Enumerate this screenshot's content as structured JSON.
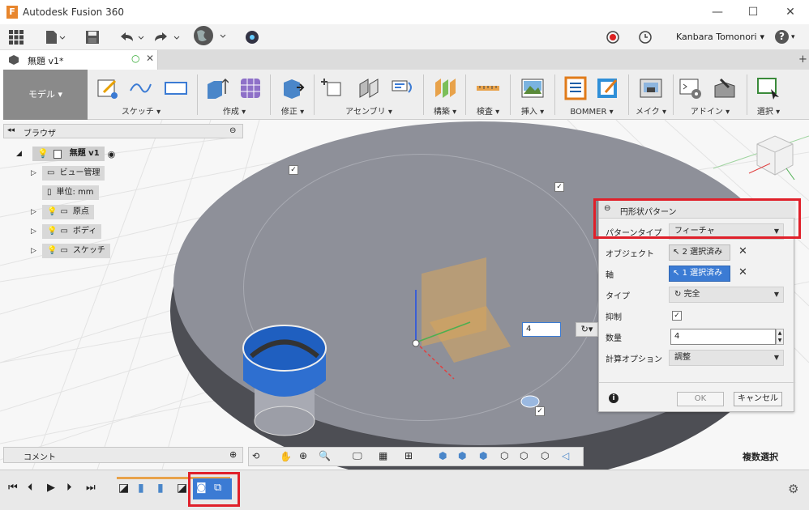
{
  "window": {
    "title": "Autodesk Fusion 360",
    "minimize": "—",
    "maximize": "☐",
    "close": "✕"
  },
  "qat": {
    "user": "Kanbara Tomonori",
    "help": "?"
  },
  "tab": {
    "name": "無題 v1*"
  },
  "ribbon": {
    "workspace": "モデル ▾",
    "groups": [
      {
        "label": "スケッチ ▾"
      },
      {
        "label": "作成 ▾"
      },
      {
        "label": "修正 ▾"
      },
      {
        "label": "アセンブリ ▾"
      },
      {
        "label": "構築 ▾"
      },
      {
        "label": "検査 ▾"
      },
      {
        "label": "挿入 ▾"
      },
      {
        "label": "BOMMER ▾"
      },
      {
        "label": "メイク ▾"
      },
      {
        "label": "アドイン ▾"
      },
      {
        "label": "選択 ▾"
      }
    ]
  },
  "browser": {
    "title": "ブラウザ",
    "root": "無題 v1",
    "items": [
      "ビュー管理",
      "単位: mm",
      "原点",
      "ボディ",
      "スケッチ"
    ]
  },
  "comment": {
    "label": "コメント"
  },
  "status": {
    "multi_select": "複数選択"
  },
  "viewport": {
    "quantity_value": "4"
  },
  "dialog": {
    "title": "円形状パターン",
    "pattern_type_label": "パターンタイプ",
    "pattern_type_value": "フィーチャ",
    "objects_label": "オブジェクト",
    "objects_value": "2 選択済み",
    "axis_label": "軸",
    "axis_value": "1 選択済み",
    "type_label": "タイプ",
    "type_value": "完全",
    "suppress_label": "抑制",
    "quantity_label": "数量",
    "quantity_value": "4",
    "compute_label": "計算オプション",
    "compute_value": "調整",
    "ok": "OK",
    "cancel": "キャンセル"
  },
  "colors": {
    "highlight": "#e0202a",
    "accent": "#3b7bd4",
    "body_top": "#8e9099",
    "body_side": "#4d4e54"
  }
}
